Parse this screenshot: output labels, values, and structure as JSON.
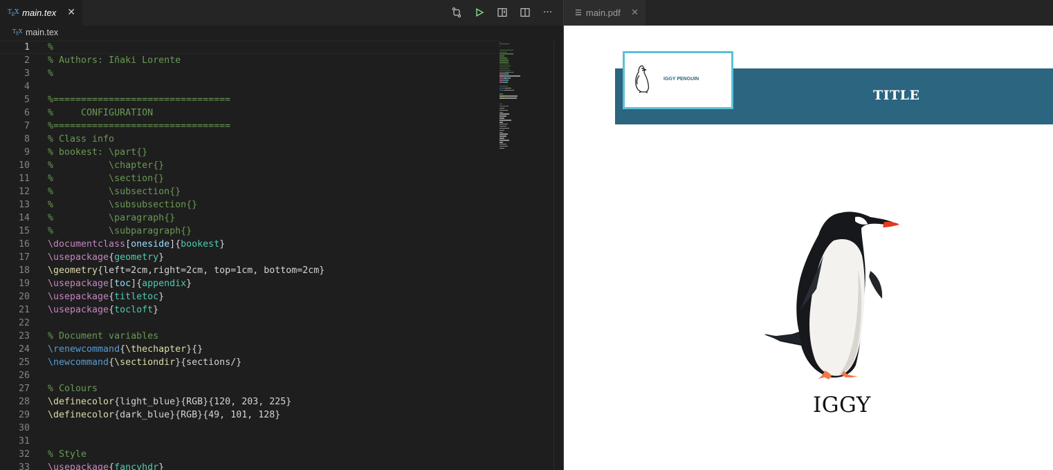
{
  "editor": {
    "tab": {
      "label": "main.tex",
      "icon": "tex-file-icon"
    },
    "breadcrumb": "main.tex",
    "lines": [
      [
        [
          "c",
          "%"
        ]
      ],
      [
        [
          "c",
          "% Authors: Iñaki Lorente"
        ]
      ],
      [
        [
          "c",
          "%"
        ]
      ],
      [],
      [
        [
          "c",
          "%================================"
        ]
      ],
      [
        [
          "c",
          "%     CONFIGURATION"
        ]
      ],
      [
        [
          "c",
          "%================================"
        ]
      ],
      [
        [
          "c",
          "% Class info"
        ]
      ],
      [
        [
          "c",
          "% bookest: \\part{}"
        ]
      ],
      [
        [
          "c",
          "%          \\chapter{}"
        ]
      ],
      [
        [
          "c",
          "%          \\section{}"
        ]
      ],
      [
        [
          "c",
          "%          \\subsection{}"
        ]
      ],
      [
        [
          "c",
          "%          \\subsubsection{}"
        ]
      ],
      [
        [
          "c",
          "%          \\paragraph{}"
        ]
      ],
      [
        [
          "c",
          "%          \\subparagraph{}"
        ]
      ],
      [
        [
          "k",
          "\\documentclass"
        ],
        [
          "w",
          "["
        ],
        [
          "a",
          "oneside"
        ],
        [
          "w",
          "]{"
        ],
        [
          "p",
          "bookest"
        ],
        [
          "w",
          "}"
        ]
      ],
      [
        [
          "k",
          "\\usepackage"
        ],
        [
          "w",
          "{"
        ],
        [
          "p",
          "geometry"
        ],
        [
          "w",
          "}"
        ]
      ],
      [
        [
          "y",
          "\\geometry"
        ],
        [
          "w",
          "{left=2cm,right=2cm, top=1cm, bottom=2cm}"
        ]
      ],
      [
        [
          "k",
          "\\usepackage"
        ],
        [
          "w",
          "["
        ],
        [
          "a",
          "toc"
        ],
        [
          "w",
          "]{"
        ],
        [
          "p",
          "appendix"
        ],
        [
          "w",
          "}"
        ]
      ],
      [
        [
          "k",
          "\\usepackage"
        ],
        [
          "w",
          "{"
        ],
        [
          "p",
          "titletoc"
        ],
        [
          "w",
          "}"
        ]
      ],
      [
        [
          "k",
          "\\usepackage"
        ],
        [
          "w",
          "{"
        ],
        [
          "p",
          "tocloft"
        ],
        [
          "w",
          "}"
        ]
      ],
      [],
      [
        [
          "c",
          "% Document variables"
        ]
      ],
      [
        [
          "b",
          "\\renewcommand"
        ],
        [
          "w",
          "{"
        ],
        [
          "y",
          "\\thechapter"
        ],
        [
          "w",
          "}{}"
        ]
      ],
      [
        [
          "b",
          "\\newcommand"
        ],
        [
          "w",
          "{"
        ],
        [
          "y",
          "\\sectiondir"
        ],
        [
          "w",
          "}{sections/}"
        ]
      ],
      [],
      [
        [
          "c",
          "% Colours"
        ]
      ],
      [
        [
          "y",
          "\\definecolor"
        ],
        [
          "w",
          "{light_blue}{RGB}{120, 203, 225}"
        ]
      ],
      [
        [
          "y",
          "\\definecolor"
        ],
        [
          "w",
          "{dark_blue}{RGB}{49, 101, 128}"
        ]
      ],
      [],
      [],
      [
        [
          "c",
          "% Style"
        ]
      ],
      [
        [
          "k",
          "\\usepackage"
        ],
        [
          "w",
          "{"
        ],
        [
          "p",
          "fancyhdr"
        ],
        [
          "w",
          "}"
        ]
      ]
    ]
  },
  "pdf": {
    "tab": {
      "label": "main.pdf",
      "icon": "document-icon"
    },
    "logo_text": "IGGY PENGUIN",
    "banner_title": "TITLE",
    "caption": "IGGY"
  },
  "colors": {
    "banner": "#2b6580",
    "logo_border": "#5bc0d8",
    "comment": "#6a9955",
    "keyword": "#c586c0"
  }
}
